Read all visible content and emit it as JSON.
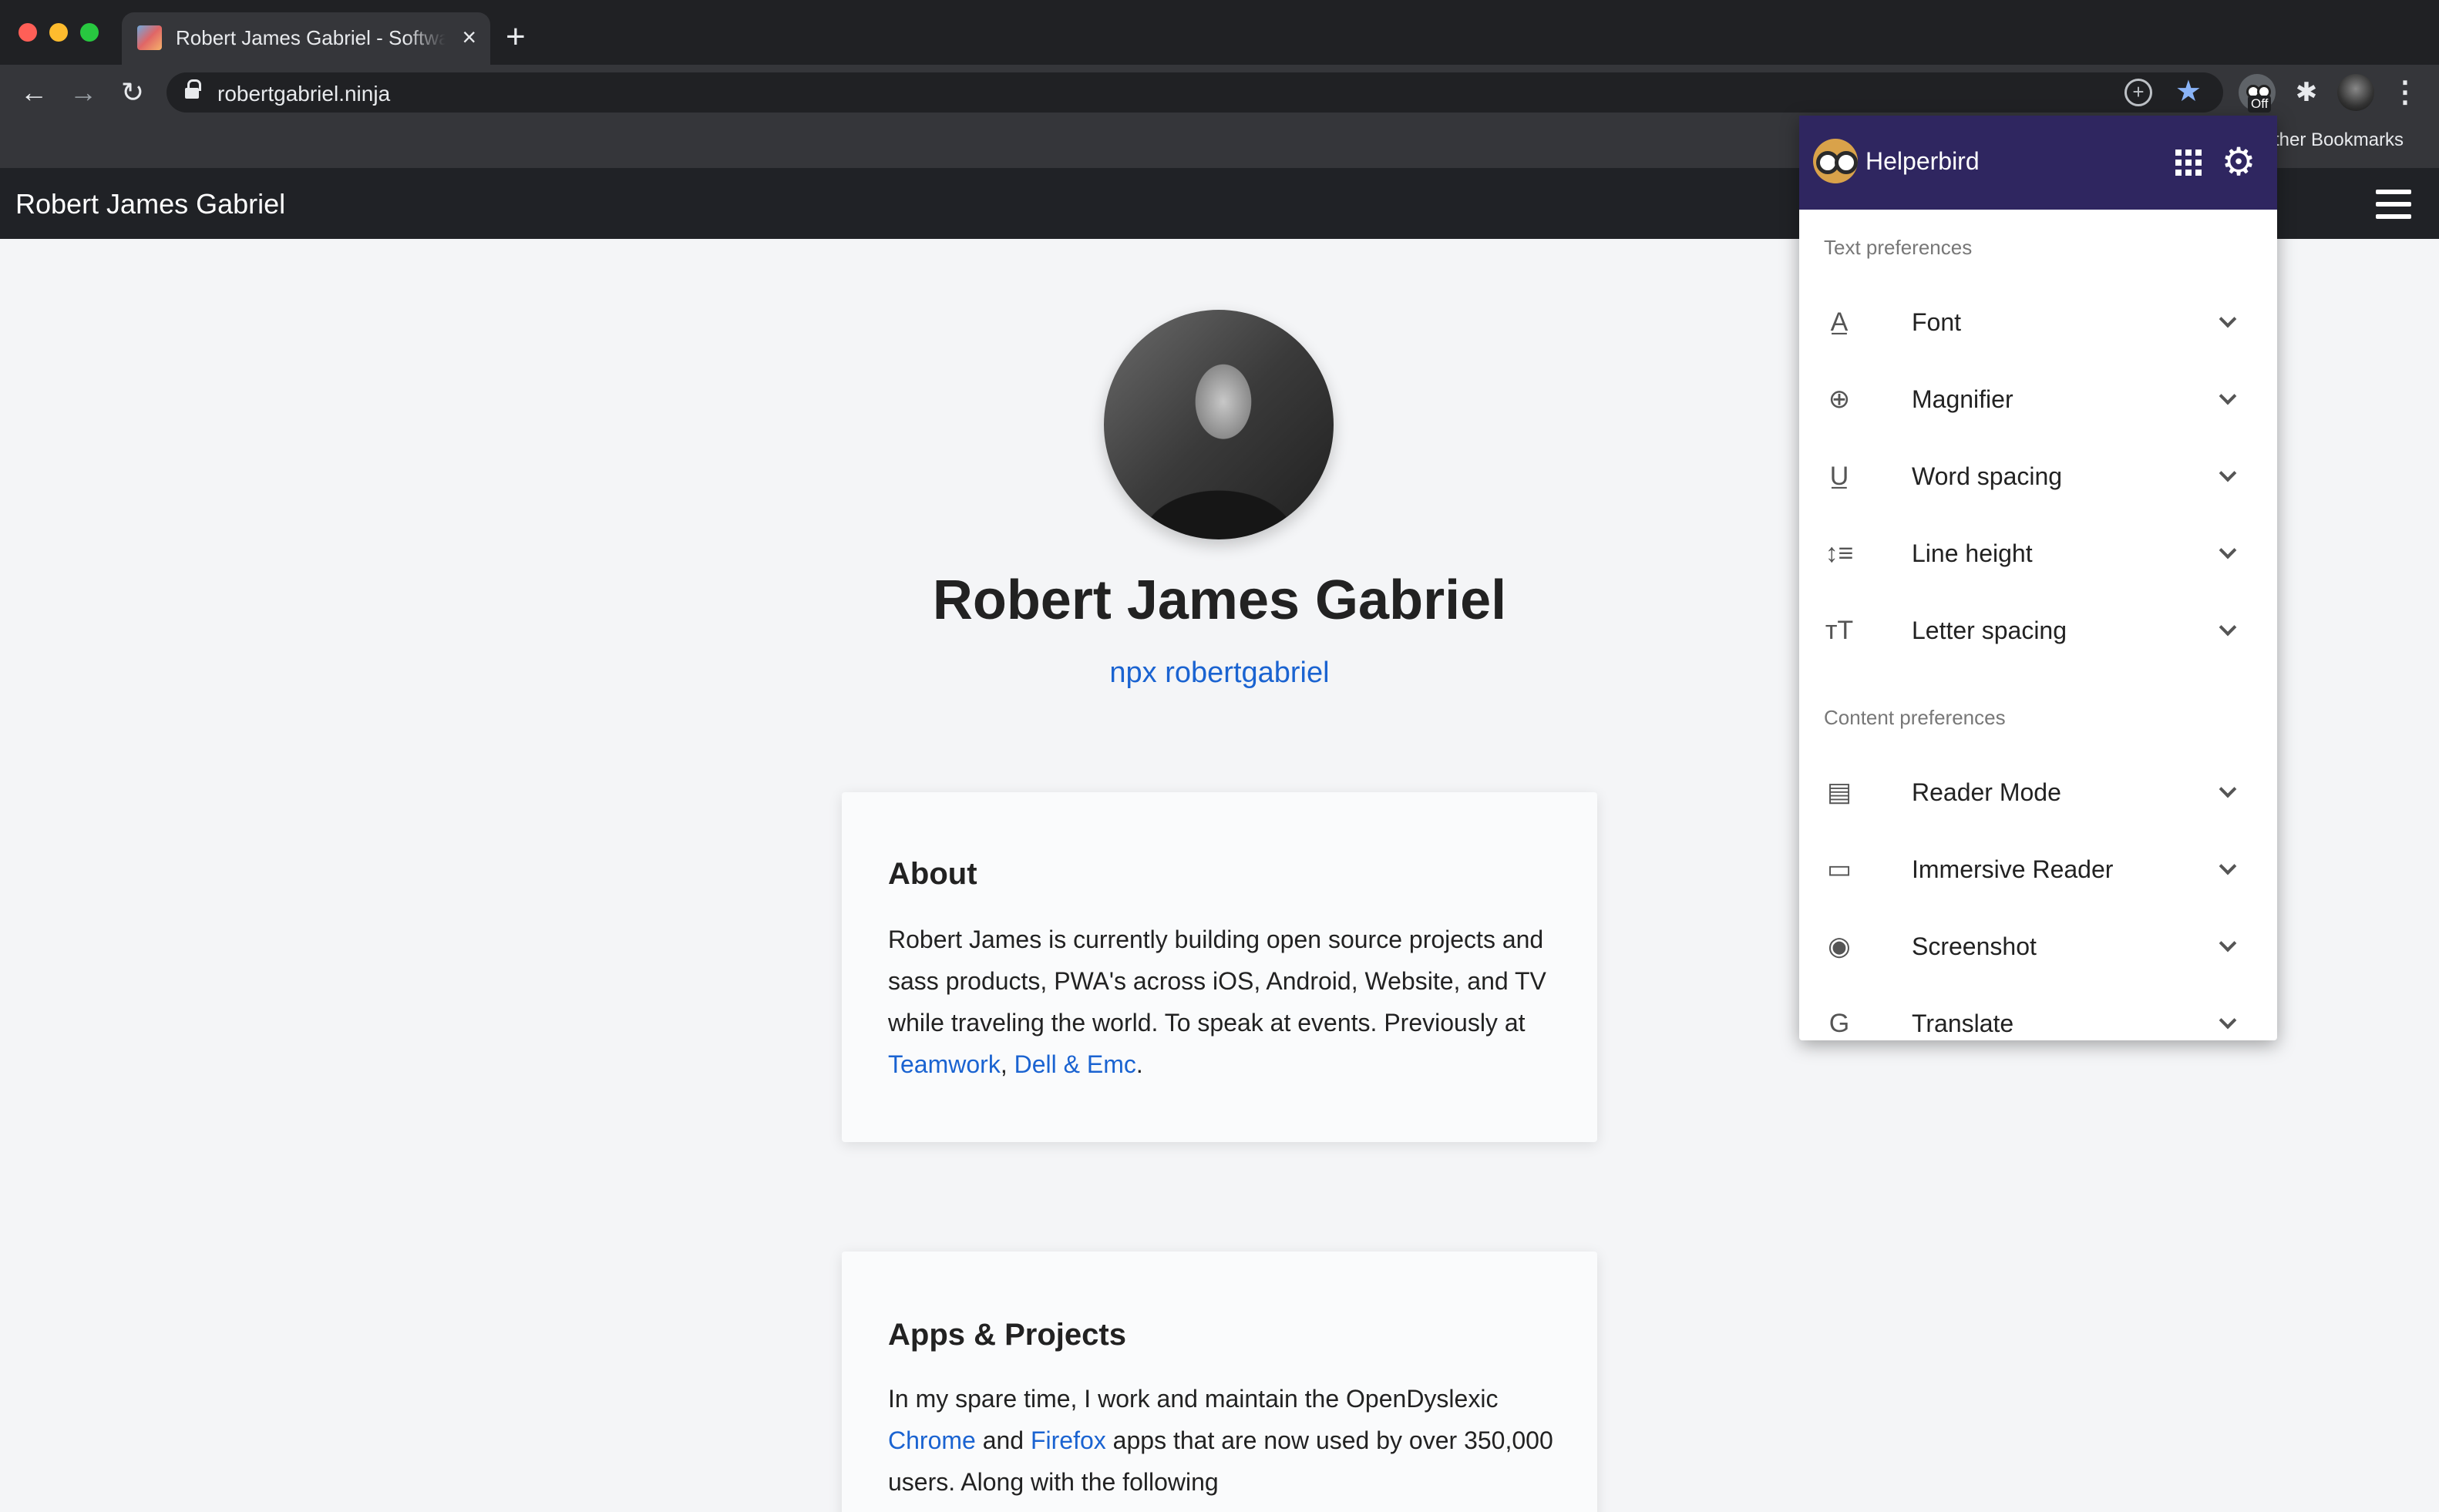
{
  "browser": {
    "tab_title": "Robert James Gabriel - Software",
    "tab_close": "×",
    "new_tab": "+",
    "nav": {
      "back": "←",
      "forward": "→",
      "reload": "↻"
    },
    "url": "robertgabriel.ninja",
    "omnibox_add": "+",
    "bookmark_star": "★",
    "extension_badge": "Off",
    "puzzle_icon": "✱",
    "menu_icon": "⋮",
    "bookmarks_bar": {
      "other_bookmarks": "ther Bookmarks"
    }
  },
  "site": {
    "brand": "Robert James Gabriel",
    "profile": {
      "name": "Robert James Gabriel",
      "npx": "npx robertgabriel"
    },
    "about": {
      "heading": "About",
      "text": "Robert James is currently building open source projects and sass products, PWA's across iOS, Android, Website, and TV while traveling the world. To speak at events. Previously at",
      "link1": "Teamwork",
      "sep": ",",
      "link2": "Dell & Emc",
      "end": "."
    },
    "apps": {
      "heading": "Apps & Projects",
      "text1": "In my spare time, I work and maintain the OpenDyslexic",
      "link_chrome": "Chrome",
      "and": "and",
      "link_firefox": "Firefox",
      "text2": "apps that are now used by over 350,000 users. Along with the following"
    }
  },
  "helperbird": {
    "title": "Helperbird",
    "gear": "⚙",
    "text_preferences_label": "Text preferences",
    "text_preferences": [
      {
        "label": "Font",
        "icon": "font-icon",
        "glyph": "A̲"
      },
      {
        "label": "Magnifier",
        "icon": "magnifier-icon",
        "glyph": "⊕"
      },
      {
        "label": "Word spacing",
        "icon": "word-spacing-icon",
        "glyph": "U̲"
      },
      {
        "label": "Line height",
        "icon": "line-height-icon",
        "glyph": "↕≡"
      },
      {
        "label": "Letter spacing",
        "icon": "letter-spacing-icon",
        "glyph": "ᴛT"
      }
    ],
    "content_preferences_label": "Content preferences",
    "content_preferences": [
      {
        "label": "Reader Mode",
        "icon": "reader-mode-icon",
        "glyph": "▤"
      },
      {
        "label": "Immersive Reader",
        "icon": "immersive-reader-icon",
        "glyph": "▭"
      },
      {
        "label": "Screenshot",
        "icon": "camera-icon",
        "glyph": "◉"
      },
      {
        "label": "Translate",
        "icon": "translate-icon",
        "glyph": "G"
      }
    ]
  },
  "colors": {
    "popup_header": "#2f2660",
    "link": "#1a63d1",
    "site_nav": "#202226"
  }
}
